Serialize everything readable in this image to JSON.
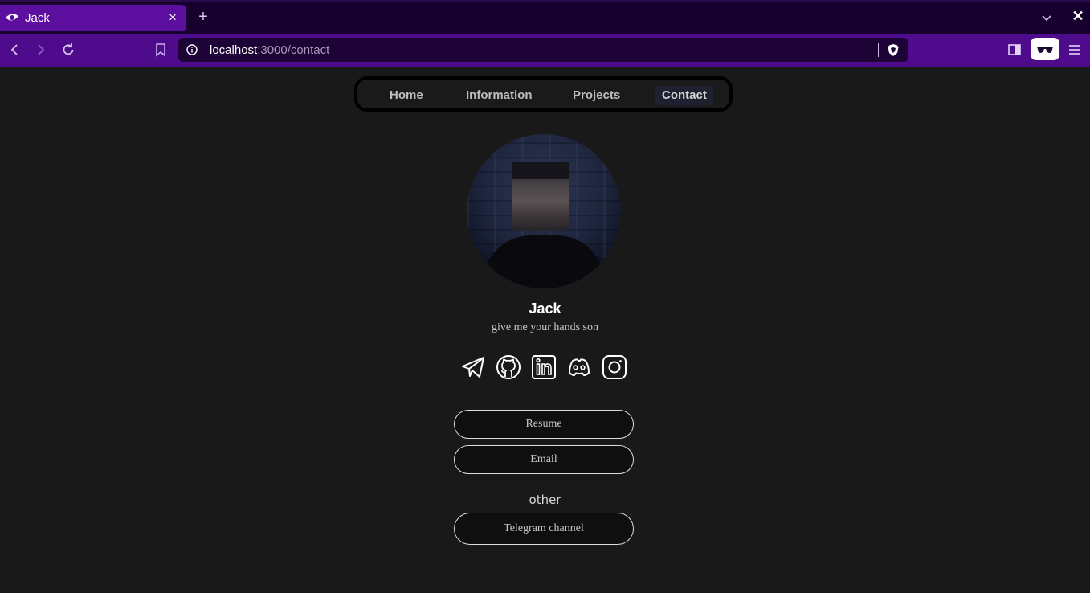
{
  "browser": {
    "tab_title": "Jack",
    "tab_close": "×",
    "new_tab": "+",
    "window_close": "✕",
    "url_host": "localhost",
    "url_path": ":3000/contact",
    "accent_color": "#4e0c8d",
    "tab_color": "#5c0e9e",
    "icons": [
      "back-icon",
      "forward-icon",
      "reload-icon",
      "bookmark-icon",
      "site-info-icon",
      "brave-shields-icon",
      "sidebar-icon",
      "wallet-icon",
      "menu-icon",
      "tab-list-icon"
    ]
  },
  "nav": {
    "items": [
      {
        "label": "Home"
      },
      {
        "label": "Information"
      },
      {
        "label": "Projects"
      },
      {
        "label": "Contact",
        "active": true
      }
    ]
  },
  "profile": {
    "name": "Jack",
    "tagline": "give me your hands son"
  },
  "socials": [
    "telegram-icon",
    "github-icon",
    "linkedin-icon",
    "discord-icon",
    "instagram-icon"
  ],
  "buttons": {
    "resume": "Resume",
    "email": "Email"
  },
  "other": {
    "label": "other",
    "telegram_channel": "Telegram channel"
  }
}
